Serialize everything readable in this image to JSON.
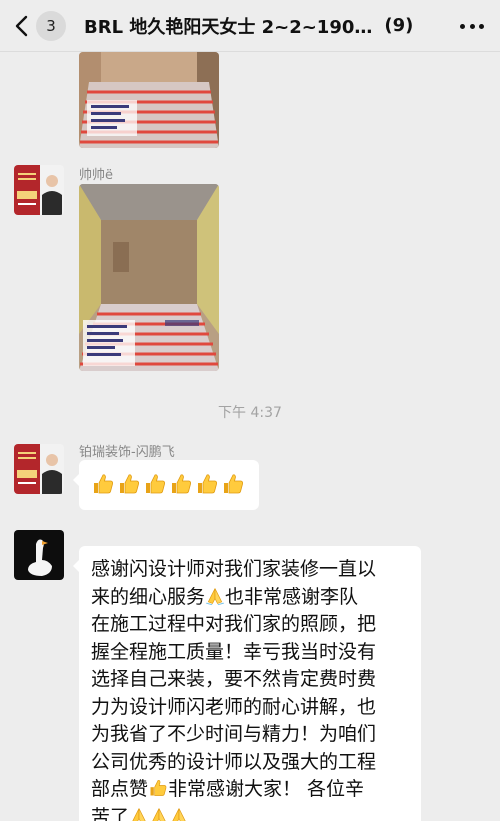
{
  "header": {
    "unread_count": "3",
    "title": "BRL 地久艳阳天女士 2~2~190…",
    "member_count": "(9)"
  },
  "messages": {
    "sender_2_name": "帅帅ë",
    "time_separator": "下午 4:37",
    "sender_3_name": "铂瑞装饰-闪鹏飞",
    "thumbs_count": 6,
    "long_text_lines": [
      "感谢闪设计师对我们家装修一直以",
      "来的细心服务",
      "也非常感谢李队",
      "在施工过程中对我们家的照顾，把",
      "握全程施工质量！幸亏我当时没有",
      "选择自己来装，要不然肯定费时费",
      "力为设计师闪老师的耐心讲解，也",
      "为我省了不少时间与精力！为咱们",
      "公司优秀的设计师以及强大的工程",
      "部点赞",
      "非常感谢大家！ 各位辛",
      "苦了"
    ]
  },
  "colors": {
    "background": "#ededed",
    "bubble": "#ffffff",
    "name_text": "#888888",
    "time_text": "#a3a3a3"
  },
  "icons": {
    "back": "chevron-left-icon",
    "more": "more-dots-icon",
    "thumbs": "thumbs-up-icon",
    "pray": "folded-hands-icon"
  }
}
